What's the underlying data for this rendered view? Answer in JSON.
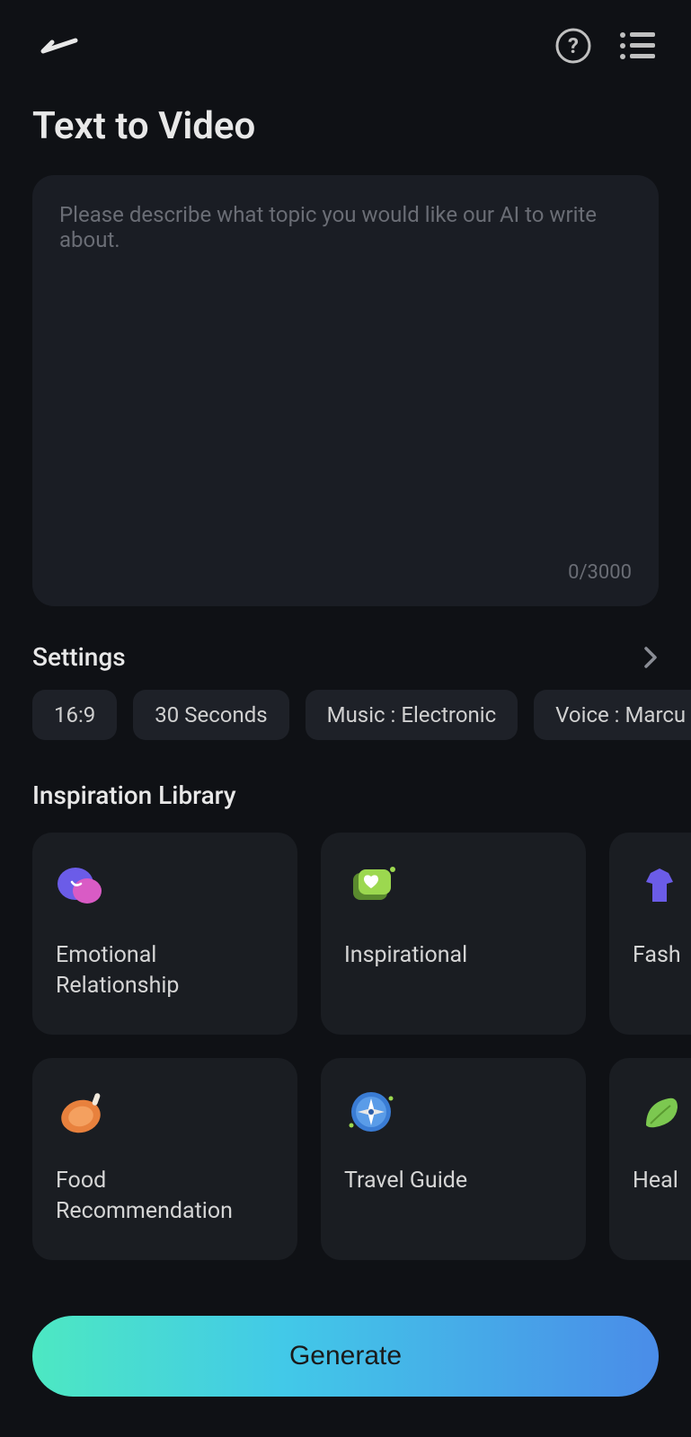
{
  "header": {
    "pageTitle": "Text to Video"
  },
  "input": {
    "placeholder": "Please describe what topic you would like our AI to write about.",
    "value": "",
    "charCounter": "0/3000"
  },
  "settings": {
    "title": "Settings",
    "chips": [
      "16:9",
      "30 Seconds",
      "Music : Electronic",
      "Voice : Marcu"
    ]
  },
  "library": {
    "title": "Inspiration Library",
    "row1": [
      {
        "label": "Emotional Relationship",
        "icon": "chat"
      },
      {
        "label": "Inspirational",
        "icon": "heart"
      },
      {
        "label": "Fash",
        "icon": "fashion"
      }
    ],
    "row2": [
      {
        "label": "Food Recommendation",
        "icon": "food"
      },
      {
        "label": "Travel Guide",
        "icon": "compass"
      },
      {
        "label": "Heal",
        "icon": "leaf"
      }
    ]
  },
  "actions": {
    "generate": "Generate"
  }
}
